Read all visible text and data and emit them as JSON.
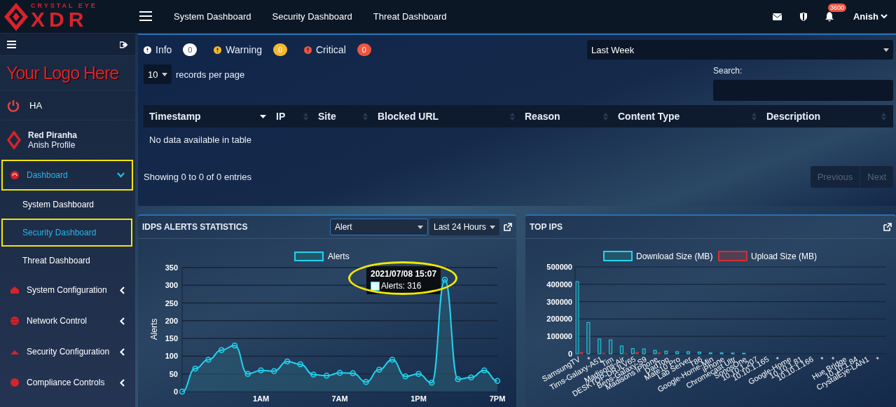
{
  "brand": {
    "tagline": "CRYSTAL EYE",
    "name": "XDR"
  },
  "top_nav": {
    "links": [
      "System Dashboard",
      "Security Dashboard",
      "Threat Dashboard"
    ],
    "notification_badge": "3600",
    "user": "Anish"
  },
  "sidebar": {
    "custom_logo": "Your Logo Here",
    "ha": "HA",
    "profile": {
      "name": "Red Piranha",
      "subtitle": "Anish Profile"
    },
    "nav": [
      {
        "label": "Dashboard",
        "selected": true,
        "expanded": true,
        "highlighted": true,
        "children": [
          {
            "label": "System Dashboard",
            "selected": false,
            "highlighted": false
          },
          {
            "label": "Security Dashboard",
            "selected": true,
            "highlighted": true
          },
          {
            "label": "Threat Dashboard",
            "selected": false,
            "highlighted": false
          }
        ]
      },
      {
        "label": "System Configuration",
        "selected": false,
        "expanded": false,
        "highlighted": false
      },
      {
        "label": "Network Control",
        "selected": false,
        "expanded": false,
        "highlighted": false
      },
      {
        "label": "Security Configuration",
        "selected": false,
        "expanded": false,
        "highlighted": false
      },
      {
        "label": "Compliance Controls",
        "selected": false,
        "expanded": false,
        "highlighted": false
      }
    ]
  },
  "scan_summary": {
    "severities": [
      {
        "label": "Info",
        "count": "0",
        "color": "#ffffff"
      },
      {
        "label": "Warning",
        "count": "0",
        "color": "#f5b82e"
      },
      {
        "label": "Critical",
        "count": "0",
        "color": "#f0553f"
      }
    ],
    "period_select": "Last Week",
    "page_length": "10",
    "page_length_label": "records per page",
    "search_label": "Search:",
    "columns": [
      {
        "label": "Timestamp",
        "sorted": true
      },
      {
        "label": "IP",
        "sorted": false
      },
      {
        "label": "Site",
        "sorted": false
      },
      {
        "label": "Blocked URL",
        "sorted": false
      },
      {
        "label": "Reason",
        "sorted": false
      },
      {
        "label": "Content Type",
        "sorted": false
      },
      {
        "label": "Description",
        "sorted": false
      }
    ],
    "empty_message": "No data available in table",
    "info": "Showing 0 to 0 of 0 entries",
    "pagination": [
      {
        "label": "Previous",
        "disabled": true
      },
      {
        "label": "Next",
        "disabled": true
      }
    ]
  },
  "idps_alerts": {
    "title": "IDPS ALERTS STATISTICS",
    "metric_select": "Alert",
    "range_select": "Last 24 Hours",
    "tooltip": {
      "title": "2021/07/08 15:07",
      "text": "Alerts: 316",
      "highlighted": true
    },
    "chart_data": {
      "type": "area",
      "grid": true,
      "legend": "top",
      "ylabel": "Alerts",
      "categories": [
        null,
        null,
        null,
        null,
        null,
        null,
        "1AM",
        null,
        null,
        null,
        null,
        null,
        "7AM",
        null,
        null,
        null,
        null,
        null,
        "1PM",
        null,
        null,
        null,
        null,
        null,
        "7PM"
      ],
      "series": [
        {
          "name": "Alerts",
          "color": "#22d3ee",
          "values": [
            0,
            65,
            90,
            117,
            130,
            50,
            60,
            58,
            85,
            77,
            48,
            45,
            53,
            52,
            27,
            62,
            90,
            43,
            50,
            25,
            316,
            35,
            40,
            60,
            30
          ]
        }
      ],
      "ylim": [
        0,
        350
      ],
      "yticks": [
        0,
        50,
        100,
        150,
        200,
        250,
        300,
        350
      ]
    }
  },
  "top_ips": {
    "title": "TOP IPS",
    "chart_data": {
      "type": "bar",
      "grid": true,
      "legend": "top",
      "categories": [
        "SamsungTV",
        "*",
        "Tims-Galaxy-A51",
        "Tim",
        "Madisons-Air",
        "DESKTOP-DRJLV65",
        "Bens-Galaxy-S9",
        "Madisons iPhone",
        "DadTop",
        "Mate10 Pro",
        "Lab Server",
        "T86",
        "Google-Home-Min",
        "iPhone",
        "Chromecast Ultr",
        "SonosOne",
        "10.10.1.207",
        "10.10.1.165",
        "*",
        "Google-Home",
        "10.10.1.81",
        "10.10.1.166",
        "*",
        "*",
        "Hue Bridge",
        "10.10.1.84",
        "CrystalEye-LAN1",
        "*"
      ],
      "series": [
        {
          "name": "Download Size (MB)",
          "color": "#22d3ee",
          "values": [
            415000,
            180000,
            85000,
            80000,
            45000,
            30000,
            28000,
            20000,
            15000,
            12000,
            12000,
            10000,
            5000,
            5000,
            4000,
            3000,
            null,
            null,
            0,
            0,
            0,
            0,
            0,
            0,
            0,
            0,
            0,
            0
          ]
        },
        {
          "name": "Upload Size (MB)",
          "color": "#d32f2f",
          "values": [
            8000,
            0,
            3000,
            0,
            1000,
            8000,
            0,
            5000,
            0,
            0,
            0,
            0,
            0,
            0,
            0,
            0,
            0,
            0,
            0,
            0,
            0,
            0,
            0,
            0,
            0,
            0,
            0,
            0
          ]
        }
      ],
      "ylim": [
        0,
        500000
      ],
      "yticks": [
        0,
        100000,
        200000,
        300000,
        400000,
        500000
      ]
    }
  }
}
